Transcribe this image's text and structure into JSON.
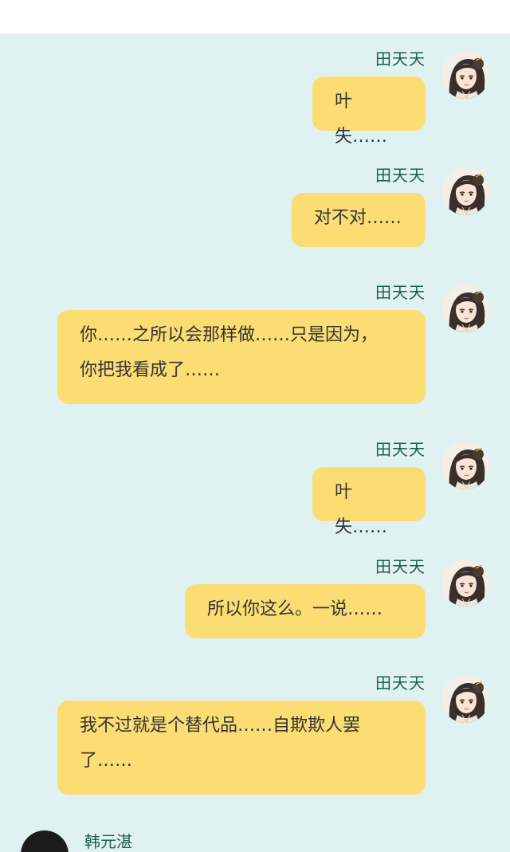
{
  "messages": [
    {
      "sender": "田天天",
      "text": "叶失……"
    },
    {
      "sender": "田天天",
      "text": "对不对……"
    },
    {
      "sender": "田天天",
      "text": "你……之所以会那样做……只是因为，你把我看成了……"
    },
    {
      "sender": "田天天",
      "text": "叶失……"
    },
    {
      "sender": "田天天",
      "text": "所以你这么。一说……"
    },
    {
      "sender": "田天天",
      "text": "我不过就是个替代品……自欺欺人罢了……"
    }
  ],
  "incoming": {
    "sender": "韩元湛"
  },
  "colors": {
    "chat_background": "#dff1f1",
    "bubble": "#fbdd73",
    "name_text": "#1f5c52",
    "message_text": "#333333"
  },
  "icons": {
    "outgoing_avatar": "girl-portrait-avatar-icon",
    "incoming_avatar": "dark-portrait-avatar-icon"
  }
}
